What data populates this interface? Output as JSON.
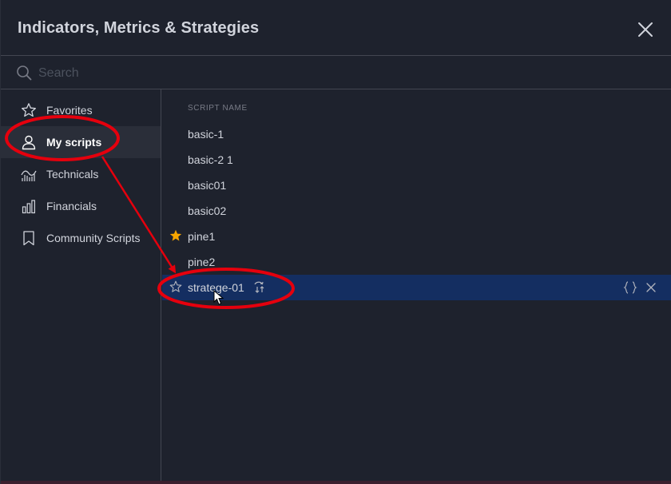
{
  "dialog": {
    "title": "Indicators, Metrics & Strategies",
    "close_icon": "close-icon"
  },
  "search": {
    "placeholder": "Search",
    "value": "",
    "icon": "search-icon"
  },
  "sidebar": {
    "items": [
      {
        "label": "Favorites",
        "icon": "star-outline-icon",
        "active": false
      },
      {
        "label": "My scripts",
        "icon": "user-icon",
        "active": true
      },
      {
        "label": "Technicals",
        "icon": "chart-wave-icon",
        "active": false
      },
      {
        "label": "Financials",
        "icon": "bar-chart-icon",
        "active": false
      },
      {
        "label": "Community Scripts",
        "icon": "bookmark-icon",
        "active": false
      }
    ]
  },
  "list": {
    "column_header": "SCRIPT NAME",
    "rows": [
      {
        "name": "basic-1",
        "favorite": false
      },
      {
        "name": "basic-2 1",
        "favorite": false
      },
      {
        "name": "basic01",
        "favorite": false
      },
      {
        "name": "basic02",
        "favorite": false
      },
      {
        "name": "pine1",
        "favorite": true
      },
      {
        "name": "pine2",
        "favorite": false
      },
      {
        "name": "stratege-01",
        "favorite": false,
        "selected": true,
        "strategy": true
      }
    ]
  },
  "colors": {
    "background": "#1e222d",
    "divider": "#434651",
    "selected_row": "#142e61",
    "favorite_star": "#f7a600",
    "annotation": "#e5000d"
  }
}
